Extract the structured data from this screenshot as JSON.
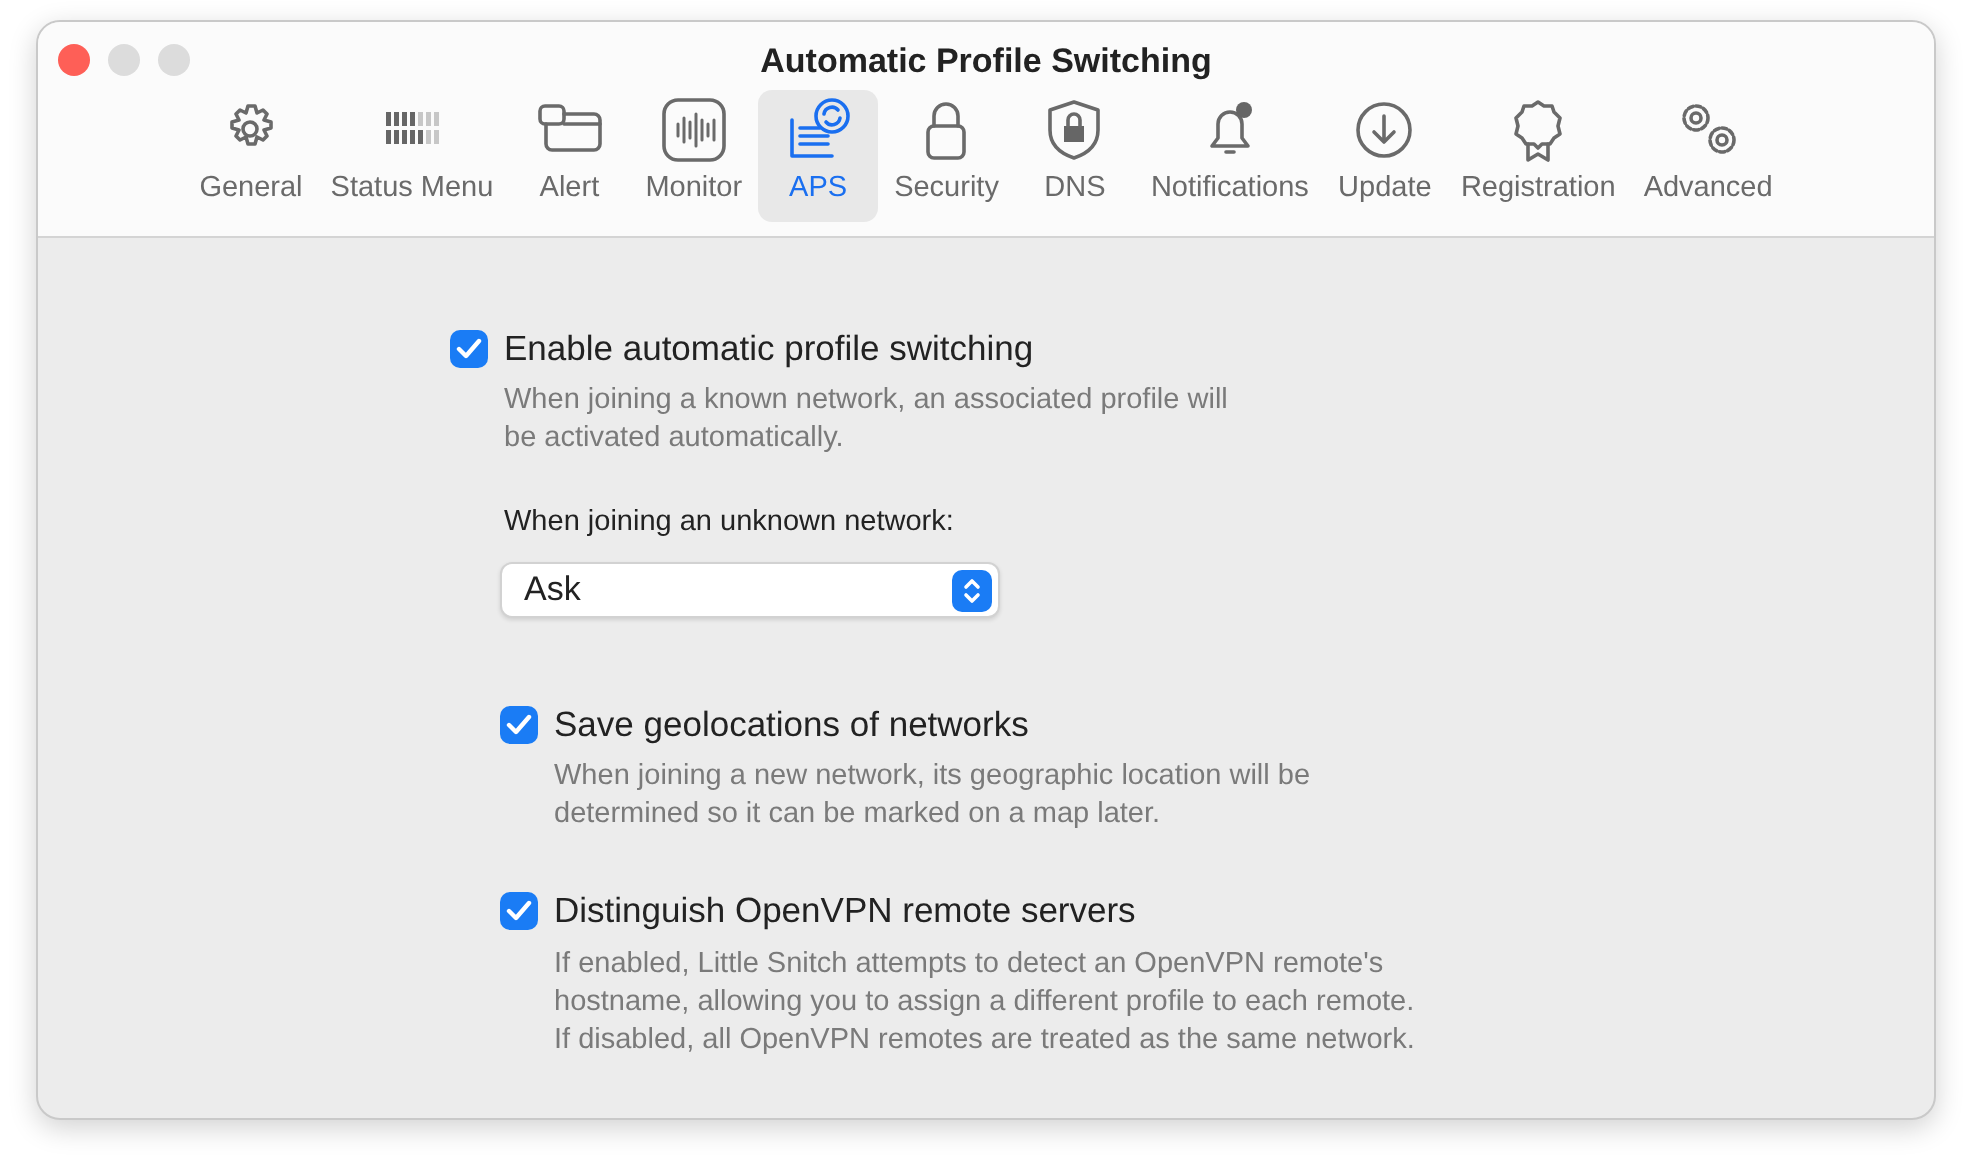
{
  "window": {
    "title": "Automatic Profile Switching"
  },
  "toolbar": [
    {
      "label": "General",
      "selected": false
    },
    {
      "label": "Status Menu",
      "selected": false
    },
    {
      "label": "Alert",
      "selected": false
    },
    {
      "label": "Monitor",
      "selected": false
    },
    {
      "label": "APS",
      "selected": true
    },
    {
      "label": "Security",
      "selected": false
    },
    {
      "label": "DNS",
      "selected": false
    },
    {
      "label": "Notifications",
      "selected": false
    },
    {
      "label": "Update",
      "selected": false
    },
    {
      "label": "Registration",
      "selected": false
    },
    {
      "label": "Advanced",
      "selected": false
    }
  ],
  "main_option": {
    "label": "Enable automatic profile switching",
    "checked": true,
    "description": [
      "When joining a known network, an associated profile will",
      "be activated automatically."
    ]
  },
  "unknown_network": {
    "label": "When joining an unknown network:",
    "value": "Ask"
  },
  "sub_options": [
    {
      "label": "Save geolocations of networks",
      "checked": true,
      "description": [
        "When joining a new network, its geographic location will be",
        "determined so it can be marked on a map later."
      ]
    },
    {
      "label": "Distinguish OpenVPN remote servers",
      "checked": true,
      "description": [
        "If enabled, Little Snitch attempts to detect an OpenVPN remote's",
        "hostname, allowing you to assign a different profile to each remote.",
        "If disabled, all OpenVPN remotes are treated as the same network."
      ]
    }
  ]
}
